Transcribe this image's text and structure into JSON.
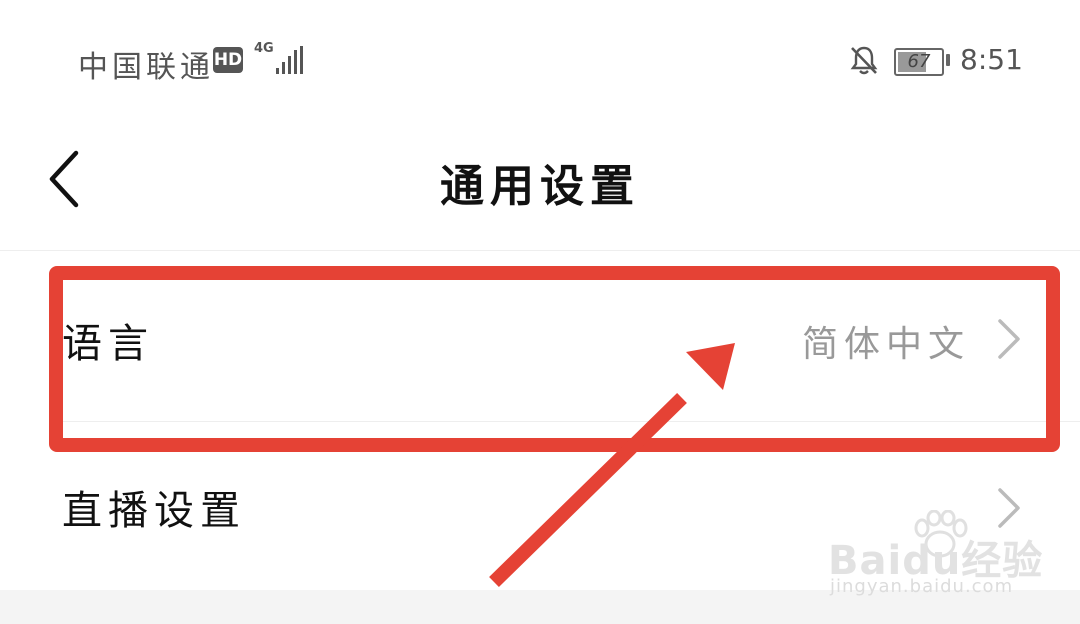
{
  "status_bar": {
    "carrier": "中国联通",
    "hd": "HD",
    "network": "4G",
    "battery": "67",
    "battery_level": 0.67,
    "time": "8:51"
  },
  "header": {
    "title": "通用设置",
    "back_icon": "chevron-left-icon"
  },
  "settings": {
    "language": {
      "label": "语言",
      "value": "简体中文"
    },
    "live": {
      "label": "直播设置"
    }
  },
  "annotation": {
    "color": "#e54235"
  },
  "watermark": {
    "brand": "Baidu经验",
    "url": "jingyan.baidu.com"
  }
}
